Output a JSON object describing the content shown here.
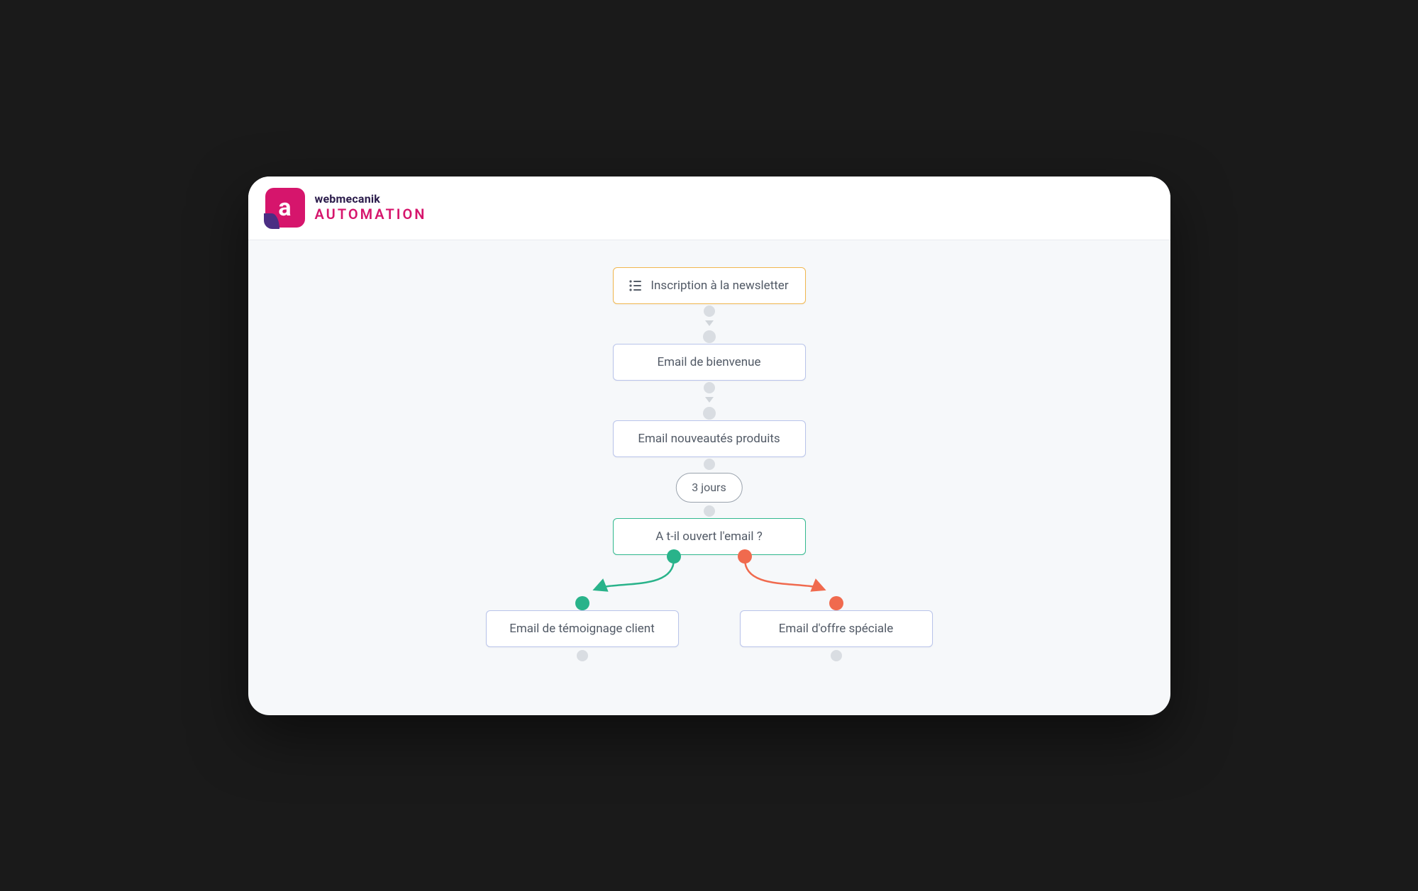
{
  "brand": {
    "glyph": "a",
    "top": "webmecanik",
    "bottom": "AUTOMATION"
  },
  "workflow": {
    "trigger": {
      "label": "Inscription à la newsletter",
      "icon": "list-icon"
    },
    "steps": [
      {
        "label": "Email de bienvenue"
      },
      {
        "label": "Email nouveautés produits"
      }
    ],
    "delay": {
      "label": "3 jours"
    },
    "decision": {
      "label": "A t-il ouvert l'email ?"
    },
    "branches": {
      "yes": {
        "label": "Email de témoignage client",
        "color": "#29b38a"
      },
      "no": {
        "label": "Email d'offre spéciale",
        "color": "#f06a4e"
      }
    }
  },
  "colors": {
    "trigger_border": "#f0b74f",
    "action_border": "#b9c4ea",
    "decision_border": "#33b98f",
    "connector": "#d0d5da",
    "brand_pink": "#d6156c",
    "brand_purple": "#4b2e83"
  }
}
